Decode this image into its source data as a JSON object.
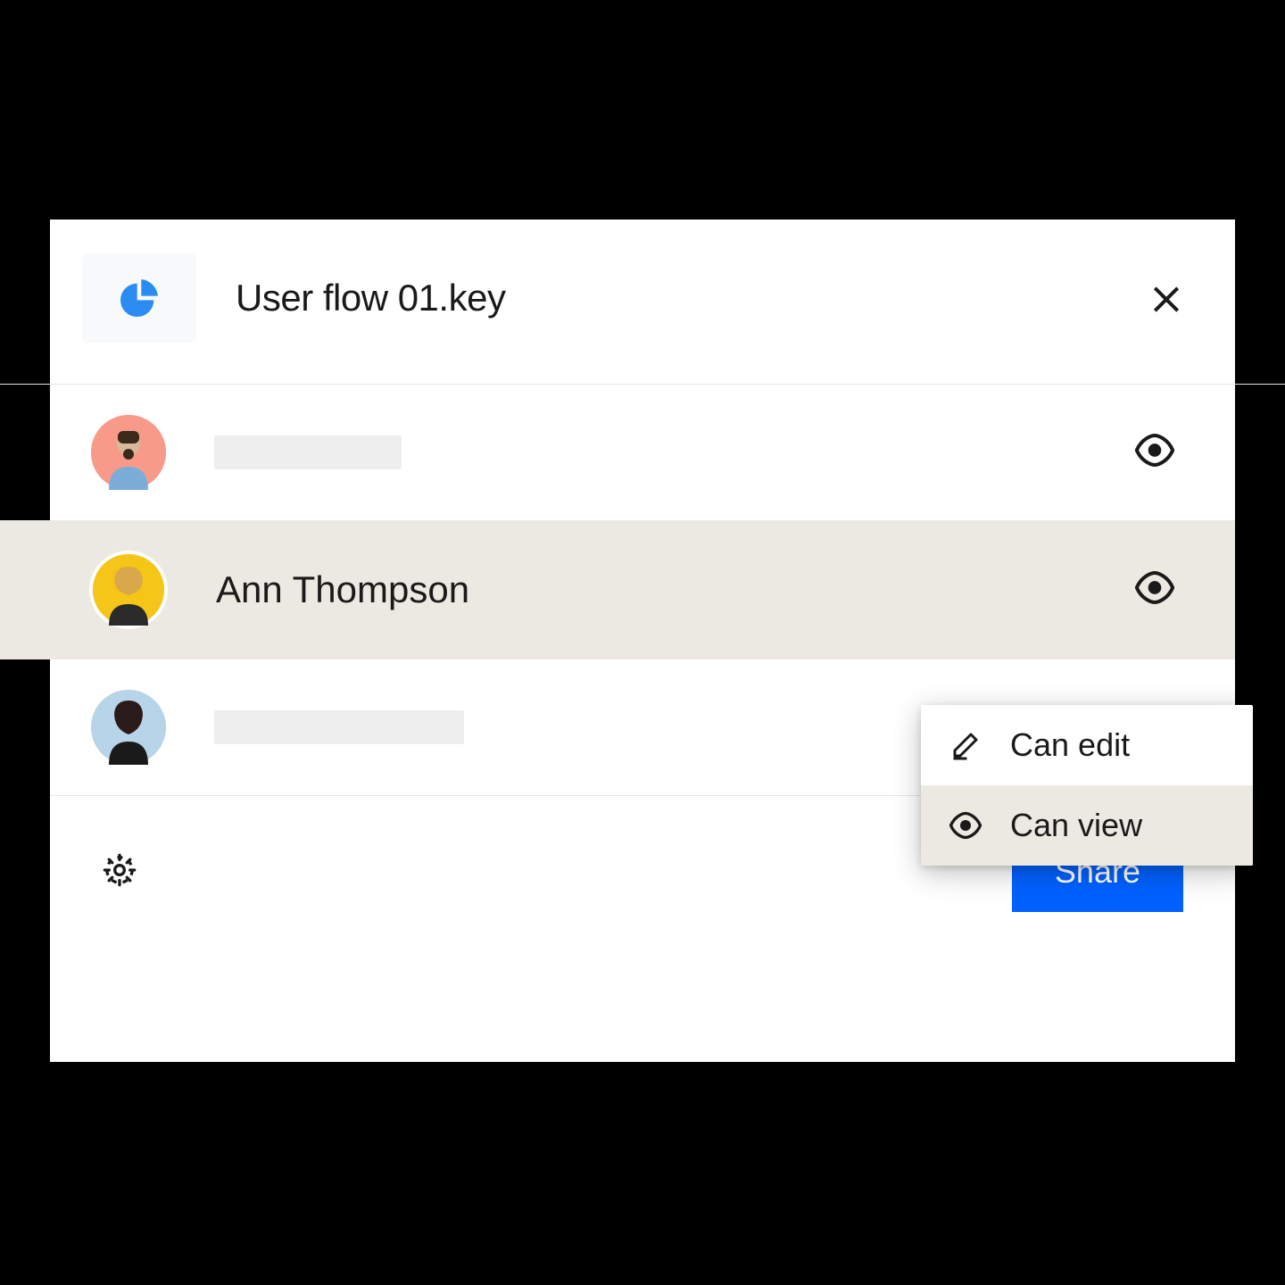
{
  "header": {
    "filename": "User flow 01.key",
    "file_icon": "pie-chart-icon",
    "close_icon": "close-icon"
  },
  "people": [
    {
      "name": "",
      "placeholder_width": 210,
      "avatar_bg": "#f79a8a",
      "permission_icon": "eye-icon",
      "highlighted": false
    },
    {
      "name": "Ann Thompson",
      "placeholder_width": 0,
      "avatar_bg": "#f5c518",
      "permission_icon": "eye-icon",
      "highlighted": true
    },
    {
      "name": "",
      "placeholder_width": 280,
      "avatar_bg": "#b8d4e8",
      "permission_icon": "",
      "highlighted": false
    }
  ],
  "dropdown": {
    "items": [
      {
        "icon": "pencil-icon",
        "label": "Can edit",
        "selected": false
      },
      {
        "icon": "eye-icon",
        "label": "Can view",
        "selected": true
      }
    ]
  },
  "footer": {
    "settings_icon": "gear-icon",
    "share_label": "Share"
  }
}
